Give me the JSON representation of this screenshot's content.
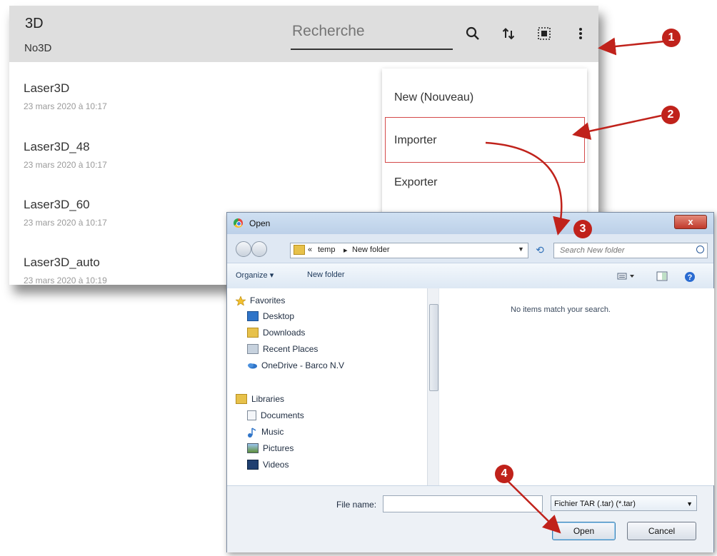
{
  "app": {
    "title": "3D",
    "subtitle": "No3D",
    "search_placeholder": "Recherche",
    "icons": [
      "search-icon",
      "sort-icon",
      "select-all-icon",
      "more-vert-icon"
    ],
    "items": [
      {
        "name": "Laser3D",
        "date": "23 mars 2020 à 10:17"
      },
      {
        "name": "Laser3D_48",
        "date": "23 mars 2020 à 10:17"
      },
      {
        "name": "Laser3D_60",
        "date": "23 mars 2020 à 10:17"
      },
      {
        "name": "Laser3D_auto",
        "date": "23 mars 2020 à 10:19"
      }
    ],
    "menu": [
      "New (Nouveau)",
      "Importer",
      "Exporter"
    ]
  },
  "dialog": {
    "title": "Open",
    "close": "x",
    "path": [
      "«",
      "temp",
      "▸",
      "New folder"
    ],
    "search_placeholder": "Search New folder",
    "toolbar": {
      "organize": "Organize ▾",
      "new_folder": "New folder"
    },
    "tree": [
      {
        "label": "Favorites",
        "icon": "star-icon",
        "group": true
      },
      {
        "label": "Desktop",
        "icon": "desktop-icon"
      },
      {
        "label": "Downloads",
        "icon": "downloads-icon"
      },
      {
        "label": "Recent Places",
        "icon": "recent-places-icon"
      },
      {
        "label": "OneDrive - Barco N.V",
        "icon": "onedrive-icon"
      },
      {
        "label": "Libraries",
        "icon": "libraries-icon",
        "group": true
      },
      {
        "label": "Documents",
        "icon": "documents-icon"
      },
      {
        "label": "Music",
        "icon": "music-icon"
      },
      {
        "label": "Pictures",
        "icon": "pictures-icon"
      },
      {
        "label": "Videos",
        "icon": "videos-icon"
      }
    ],
    "empty_message": "No items match your search.",
    "file_name_label": "File name:",
    "file_name_value": "",
    "file_type": "Fichier TAR (.tar) (*.tar)",
    "open_button": "Open",
    "cancel_button": "Cancel"
  },
  "callouts": [
    "1",
    "2",
    "3",
    "4"
  ],
  "colors": {
    "callout": "#c0221b",
    "highlight": "#d44a4a",
    "header": "#dedede",
    "dialog_bg": "#dfe8f3"
  }
}
